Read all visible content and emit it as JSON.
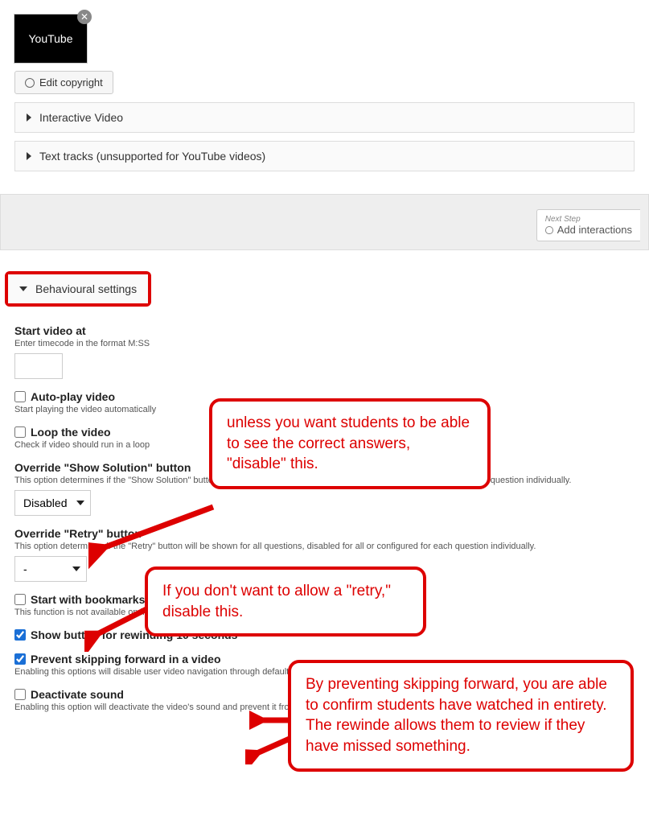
{
  "thumb": {
    "label": "YouTube"
  },
  "buttons": {
    "edit_copyright": "Edit copyright"
  },
  "accordions": {
    "interactive_video": "Interactive Video",
    "text_tracks": "Text tracks (unsupported for YouTube videos)"
  },
  "next_step": {
    "label": "Next Step",
    "action": "Add interactions"
  },
  "section": {
    "title": "Behavioural settings"
  },
  "fields": {
    "start_at": {
      "label": "Start video at",
      "hint": "Enter timecode in the format M:SS",
      "value": ""
    },
    "autoplay": {
      "label": "Auto-play video",
      "hint": "Start playing the video automatically",
      "checked": false
    },
    "loop": {
      "label": "Loop the video",
      "hint": "Check if video should run in a loop",
      "checked": false
    },
    "override_solution": {
      "label": "Override \"Show Solution\" button",
      "hint": "This option determines if the \"Show Solution\" button will be shown for all questions, disabled for all or configured for each question individually.",
      "value": "Disabled"
    },
    "override_retry": {
      "label": "Override \"Retry\" button",
      "hint": "This option determines if the \"Retry\" button will be shown for all questions, disabled for all or configured for each question individually.",
      "value": "-"
    },
    "bookmarks": {
      "label": "Start with bookmarks menu open",
      "hint": "This function is not available on iPad when using YouTube as video source.",
      "checked": false
    },
    "rewind10": {
      "label": "Show button for rewinding 10 seconds",
      "checked": true
    },
    "prevent_skip": {
      "label": "Prevent skipping forward in a video",
      "hint": "Enabling this options will disable user video navigation through default controls.",
      "checked": true
    },
    "deactivate_sound": {
      "label": "Deactivate sound",
      "hint": "Enabling this option will deactivate the video's sound and prevent it from being switched on.",
      "checked": false
    }
  },
  "callouts": {
    "c1": "unless you want students to be able to see the correct answers, \"disable\" this.",
    "c2": "If you don't want to allow a \"retry,\" disable this.",
    "c3": "By preventing skipping forward, you are able to confirm students have watched in entirety. The rewinde allows them to review if they have missed something."
  }
}
